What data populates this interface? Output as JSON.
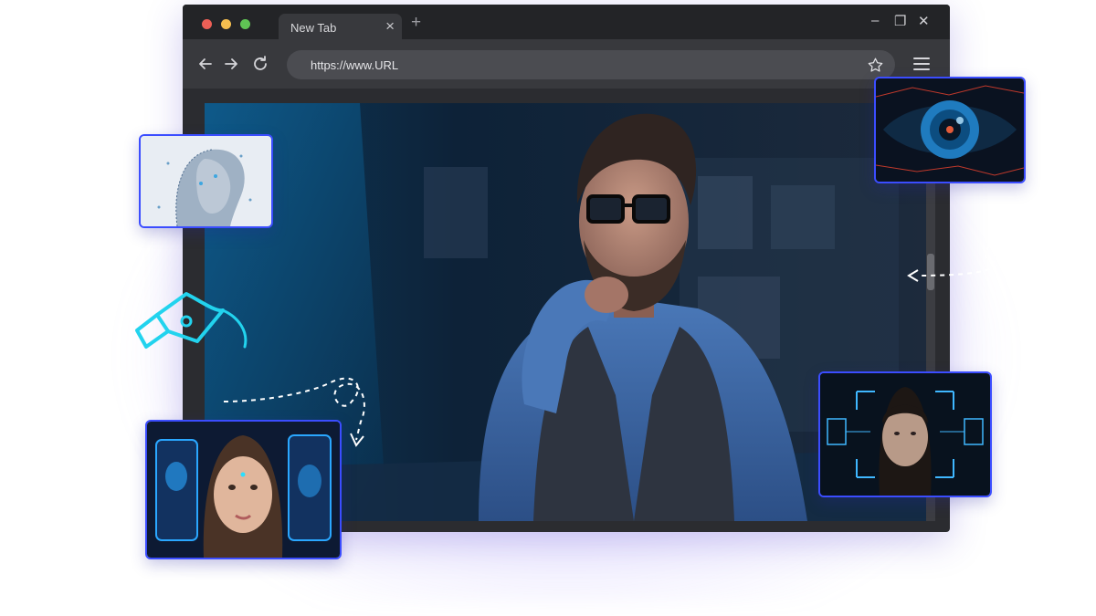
{
  "browser": {
    "tab_title": "New Tab",
    "tab_close": "×",
    "new_tab": "+",
    "url": "https://www.URL"
  },
  "window_controls": {
    "minimize": "–",
    "restore": "❐",
    "close": "✕"
  },
  "colors": {
    "accent": "#3b4dff",
    "cyan": "#22d3ee",
    "browser_bg": "#2b2c30",
    "toolbar_bg": "#38393d",
    "traffic_red": "#ed5f56",
    "traffic_yellow": "#f5be4f",
    "traffic_green": "#5fc454"
  },
  "icons": [
    "back-arrow-icon",
    "forward-arrow-icon",
    "reload-icon",
    "star-icon",
    "hamburger-menu-icon",
    "pen-tool-icon"
  ],
  "images": [
    "man-at-computer-photo",
    "ai-digital-face-image",
    "cyber-eye-image",
    "face-scan-woman-image",
    "face-recognition-man-image"
  ]
}
